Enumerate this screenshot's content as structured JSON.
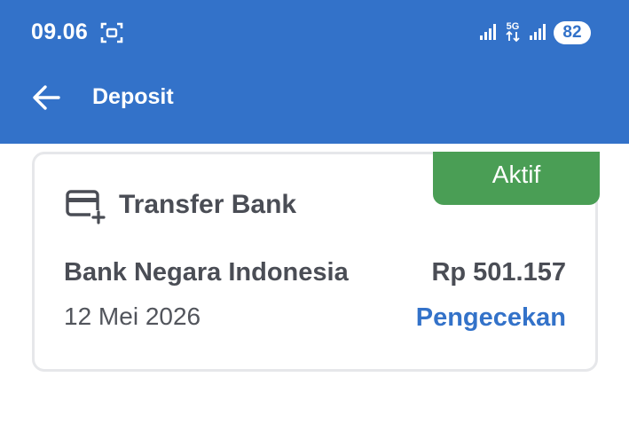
{
  "status_bar": {
    "time": "09.06",
    "network": "5G",
    "battery": "82"
  },
  "header": {
    "title": "Deposit",
    "icons": {
      "back": "arrow-left-icon"
    }
  },
  "transaction": {
    "method": "Transfer Bank",
    "badge": "Aktif",
    "bank": "Bank Negara Indonesia",
    "amount": "Rp 501.157",
    "date": "12 Mei 2026",
    "status": "Pengecekan",
    "icon": "card-add-icon"
  },
  "colors": {
    "primary": "#3372c9",
    "success": "#4a9e55",
    "text": "#4a4d55",
    "border": "#e6e7ea"
  }
}
